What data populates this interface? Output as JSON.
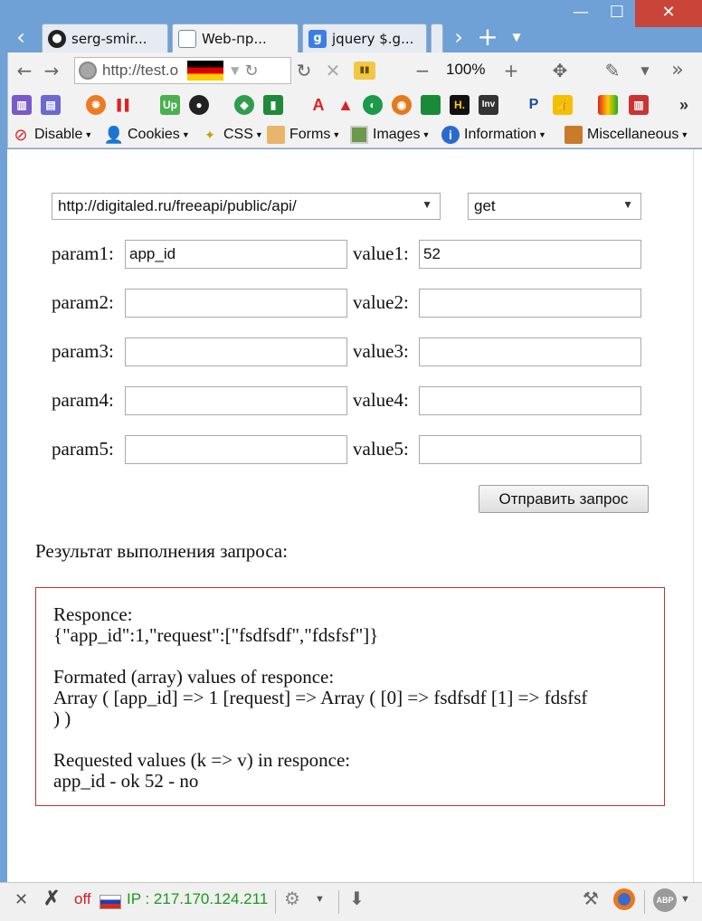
{
  "browser": {
    "tabs": [
      {
        "label": "serg-smir...",
        "icon": "github-icon"
      },
      {
        "label": "Web-пр...",
        "icon": "document-icon",
        "active": true
      },
      {
        "label": "jquery $.g...",
        "icon": "google-icon"
      }
    ],
    "url": "http://test.o",
    "zoom": "100%"
  },
  "webdev": {
    "items": [
      "Disable",
      "Cookies",
      "CSS",
      "Forms",
      "Images",
      "Information",
      "Miscellaneous"
    ]
  },
  "form": {
    "url_select": "http://digitaled.ru/freeapi/public/api/",
    "method_select": "get",
    "rows": [
      {
        "param_label": "param1:",
        "param_value": "app_id",
        "value_label": "value1:",
        "value_value": "52"
      },
      {
        "param_label": "param2:",
        "param_value": "",
        "value_label": "value2:",
        "value_value": ""
      },
      {
        "param_label": "param3:",
        "param_value": "",
        "value_label": "value3:",
        "value_value": ""
      },
      {
        "param_label": "param4:",
        "param_value": "",
        "value_label": "value4:",
        "value_value": ""
      },
      {
        "param_label": "param5:",
        "param_value": "",
        "value_label": "value5:",
        "value_value": ""
      }
    ],
    "submit_label": "Отправить запрос"
  },
  "result": {
    "title": "Результат выполнения запроса:",
    "responce_label": "Responce:",
    "responce_json": "{\"app_id\":1,\"request\":[\"fsdfsdf\",\"fdsfsf\"]}",
    "formated_label": "Formated (array) values of responce:",
    "formated_line1": "Array ( [app_id] => 1 [request] => Array ( [0] => fsdfsdf [1] => fdsfsf",
    "formated_line2": ") )",
    "requested_label": "Requested values (k => v) in responce:",
    "requested_values": "app_id - ok 52 - no"
  },
  "statusbar": {
    "off_label": "off",
    "ip_text": "IP : 217.170.124.211"
  },
  "colors": {
    "chrome_blue": "#6fa0d6",
    "close_red": "#c9453a",
    "result_border": "#bb3333",
    "ip_green": "#1a9a1a",
    "off_red": "#cc2222"
  }
}
